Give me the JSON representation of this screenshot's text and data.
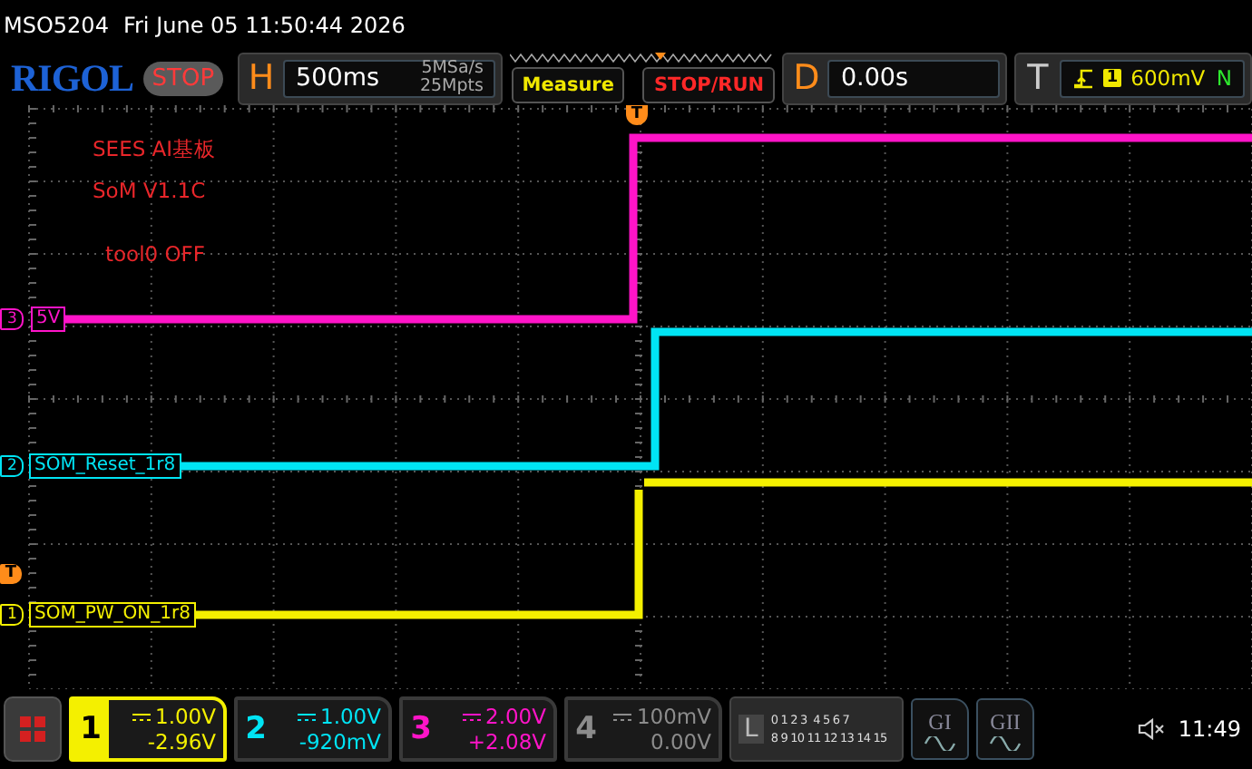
{
  "status_bar": {
    "model": "MSO5204",
    "datetime": "Fri June 05 11:50:44 2026"
  },
  "toolbar": {
    "logo": "RIGOL",
    "run_state": "STOP",
    "horizontal": {
      "key": "H",
      "timebase": "500ms",
      "sample_rate": "5MSa/s",
      "memory_depth": "25Mpts"
    },
    "buttons": [
      {
        "label": "Measure",
        "kind": "measure"
      },
      {
        "label": "STOP/RUN",
        "kind": "run"
      }
    ],
    "delay": {
      "key": "D",
      "value": "0.00s"
    },
    "trigger": {
      "key": "T",
      "source": "1",
      "level": "600mV",
      "mode": "N"
    }
  },
  "screen": {
    "notes": [
      "SEES AI基板",
      "SoM V1.1C",
      "tool0 OFF"
    ],
    "trigger_position_marker": "T",
    "trigger_level_marker": "T",
    "traces": [
      {
        "channel": "3",
        "label": "5V",
        "color": "#ff14c8"
      },
      {
        "channel": "2",
        "label": "SOM_Reset_1r8",
        "color": "#00e4f4"
      },
      {
        "channel": "1",
        "label": "SOM_PW_ON_1r8",
        "color": "#f4f000"
      }
    ]
  },
  "channels": [
    {
      "number": "1",
      "scale": "1.00V",
      "offset": "-2.96V",
      "color": "#f4f000",
      "selected": true
    },
    {
      "number": "2",
      "scale": "1.00V",
      "offset": "-920mV",
      "color": "#00e4f4",
      "selected": false
    },
    {
      "number": "3",
      "scale": "2.00V",
      "offset": "+2.08V",
      "color": "#ff14c8",
      "selected": false
    },
    {
      "number": "4",
      "scale": "100mV",
      "offset": "0.00V",
      "color": "#8c8c8c",
      "selected": false
    }
  ],
  "logic": {
    "key": "L",
    "bits_row_1": "0 1 2 3  4 5 6 7",
    "bits_row_2": "8 9 10 11 12 13 14 15"
  },
  "generators": [
    "GI",
    "GII"
  ],
  "clock": "11:49"
}
